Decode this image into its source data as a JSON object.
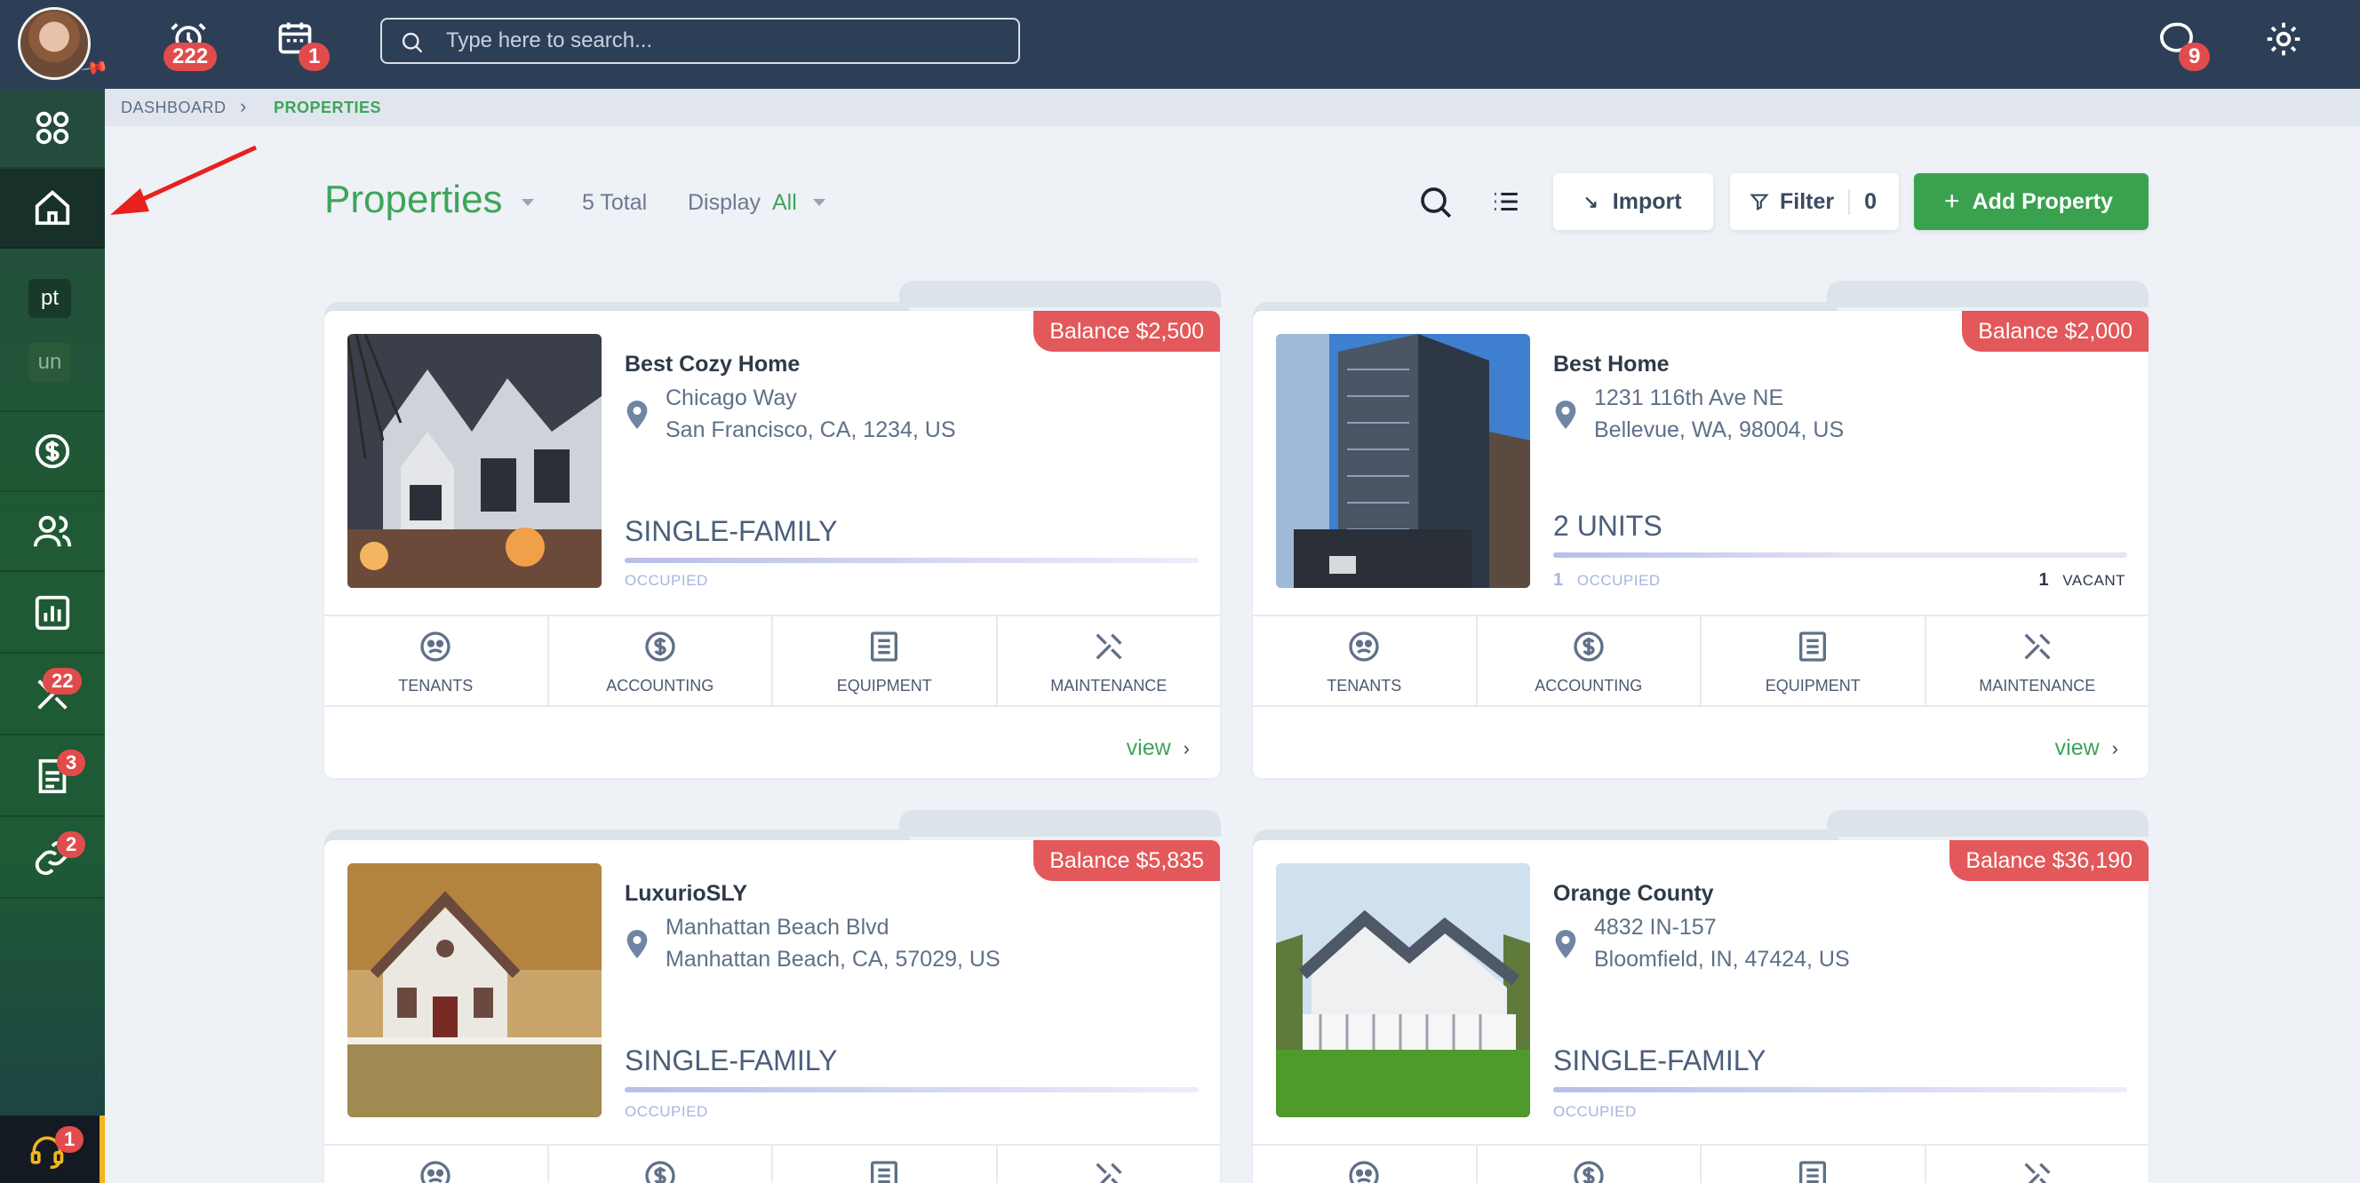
{
  "topbar": {
    "alarm_count": "222",
    "calendar_count": "1",
    "search_placeholder": "Type here to search...",
    "messages_count": "9"
  },
  "sidebar": {
    "chip_pt": "pt",
    "chip_un": "un",
    "maintenance_count": "22",
    "documents_count": "3",
    "links_count": "2",
    "support_count": "1"
  },
  "breadcrumb": {
    "dashboard": "DASHBOARD",
    "separator": "›",
    "current": "PROPERTIES"
  },
  "header": {
    "title": "Properties",
    "total": "5 Total",
    "display_label": "Display",
    "display_value": "All",
    "import_label": "Import",
    "filter_label": "Filter",
    "filter_count": "0",
    "add_label": "Add Property"
  },
  "action_labels": {
    "tenants": "TENANTS",
    "accounting": "ACCOUNTING",
    "equipment": "EQUIPMENT",
    "maintenance": "MAINTENANCE",
    "view": "view"
  },
  "properties": [
    {
      "balance": "Balance $2,500",
      "name": "Best Cozy Home",
      "address_line1": "Chicago Way",
      "address_line2": "San Francisco, CA, 1234, US",
      "type": "SINGLE-FAMILY",
      "status": "OCCUPIED"
    },
    {
      "balance": "Balance $2,000",
      "name": "Best Home",
      "address_line1": "1231 116th Ave NE",
      "address_line2": "Bellevue, WA, 98004, US",
      "type": "2 UNITS",
      "occupied_count": "1",
      "occupied_label": "OCCUPIED",
      "vacant_count": "1",
      "vacant_label": "VACANT",
      "occupied_fraction": 0.5
    },
    {
      "balance": "Balance $5,835",
      "name": "LuxurioSLY",
      "address_line1": "Manhattan Beach Blvd",
      "address_line2": "Manhattan Beach, CA, 57029, US",
      "type": "SINGLE-FAMILY",
      "status": "OCCUPIED"
    },
    {
      "balance": "Balance $36,190",
      "name": "Orange County",
      "address_line1": "4832 IN-157",
      "address_line2": "Bloomfield, IN, 47424, US",
      "type": "SINGLE-FAMILY",
      "status": "OCCUPIED"
    }
  ],
  "colors": {
    "accent_green": "#3da55a",
    "balance_red": "#e3585a",
    "topbar": "#2d3f57"
  }
}
